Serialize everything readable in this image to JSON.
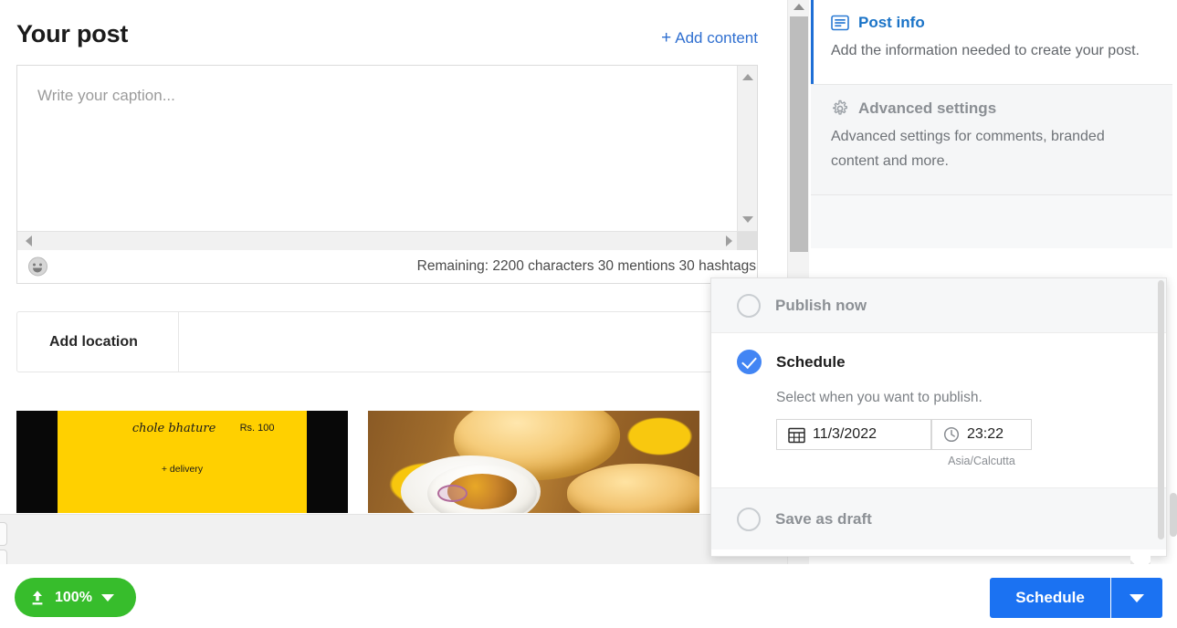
{
  "post": {
    "title": "Your post",
    "add_content_label": "Add content",
    "add_content_icon": "plus-icon",
    "caption_placeholder": "Write your caption...",
    "emoji_icon": "emoji-smiley-icon",
    "remaining_text": "Remaining: 2200 characters 30 mentions 30 hashtags",
    "location_label": "Add location"
  },
  "thumbnails": [
    {
      "name": "chole bhature",
      "price": "Rs. 100",
      "delivery": "+ delivery",
      "bg_color": "#ffd000",
      "letterbox_color": "#080808"
    },
    {
      "name": "chole-bhature-photo",
      "description": "Photo of chole bhature with curry bowl"
    }
  ],
  "right_panel": {
    "cards": [
      {
        "icon": "document-lines-icon",
        "title": "Post info",
        "description": "Add the information needed to create your post.",
        "active": true,
        "accent_color": "#1f6fd6"
      },
      {
        "icon": "gear-icon",
        "title": "Advanced settings",
        "description": "Advanced settings for comments, branded content and more.",
        "active": false
      }
    ]
  },
  "schedule_popup": {
    "options": [
      {
        "label": "Publish now",
        "selected": false
      },
      {
        "label": "Schedule",
        "selected": true
      },
      {
        "label": "Save as draft",
        "selected": false
      }
    ],
    "schedule_hint": "Select when you want to publish.",
    "date_icon": "calendar-icon",
    "date_value": "11/3/2022",
    "time_icon": "clock-icon",
    "time_value": "23:22",
    "timezone": "Asia/Calcutta",
    "check_color": "#4285f4"
  },
  "footer": {
    "upload_icon": "upload-icon",
    "upload_percent": "100%",
    "upload_caret_icon": "chevron-down-icon",
    "upload_color": "#37bd2c",
    "schedule_button_label": "Schedule",
    "schedule_dropdown_icon": "chevron-down-icon",
    "schedule_color": "#1b72f2"
  }
}
